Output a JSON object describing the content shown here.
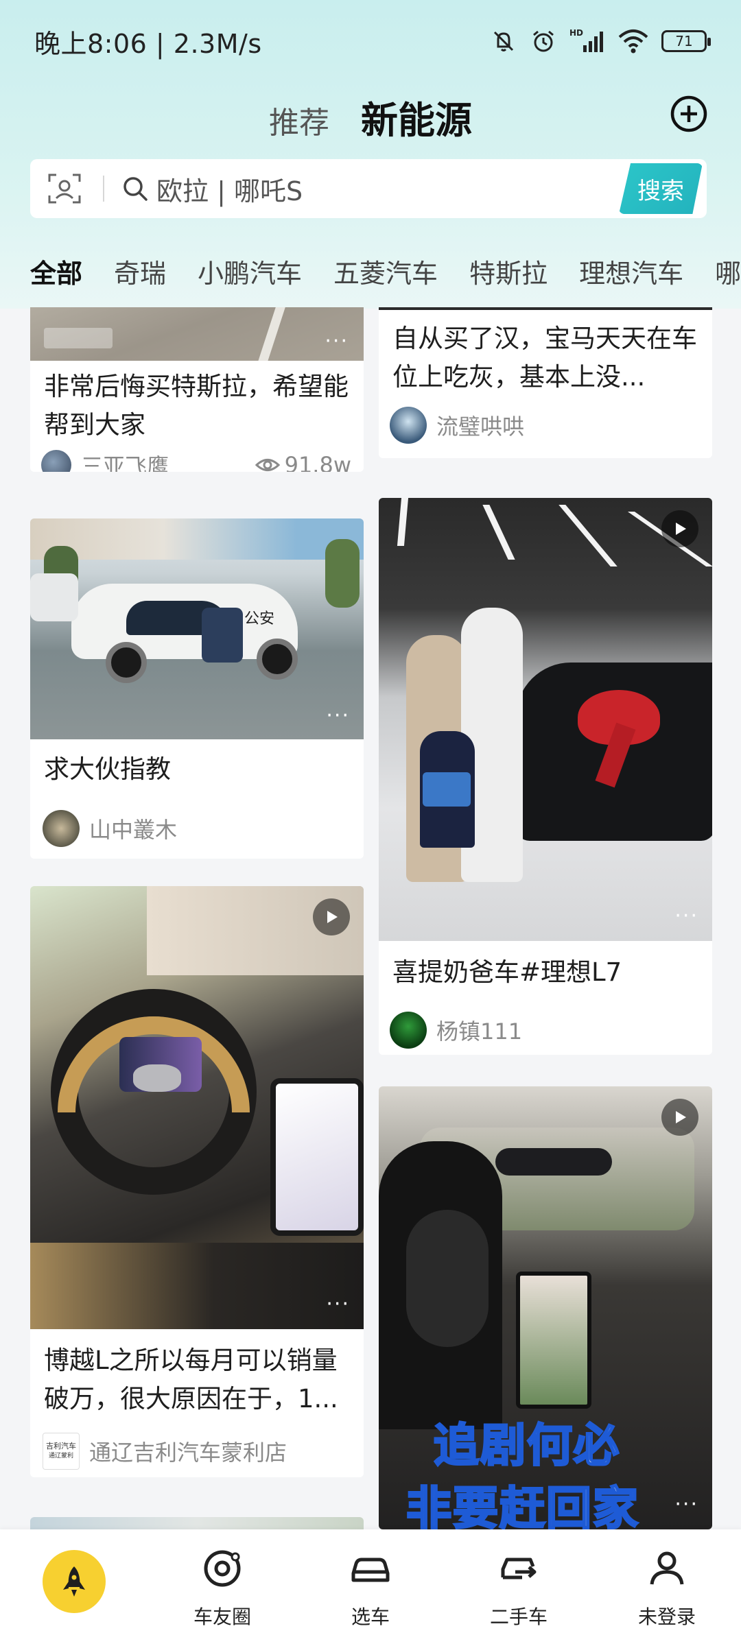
{
  "status_bar": {
    "time_speed": "晚上8:06 | 2.3M/s",
    "battery": "71"
  },
  "header": {
    "tab_recommend": "推荐",
    "tab_new_energy": "新能源"
  },
  "search": {
    "placeholder": "欧拉 | 哪吒S",
    "button_label": "搜索"
  },
  "categories": [
    "全部",
    "奇瑞",
    "小鹏汽车",
    "五菱汽车",
    "特斯拉",
    "理想汽车",
    "哪"
  ],
  "feed": {
    "left": [
      {
        "title": "非常后悔买特斯拉，希望能帮到大家",
        "author": "三亚飞鹰",
        "views": "91.8w"
      },
      {
        "title": "求大伙指教",
        "author": "山中叢木"
      },
      {
        "title": "博越L之所以每月可以销量破万，很大原因在于，1...",
        "author": "通辽吉利汽车蒙利店"
      }
    ],
    "right": [
      {
        "title": "自从买了汉，宝马天天在车位上吃灰，基本上没...",
        "author": "流璧哄哄"
      },
      {
        "title": "喜提奶爸车#理想L7",
        "author": "杨镇111"
      },
      {
        "overlay_text_1": "追剧何必",
        "overlay_text_2": "非要赶回家"
      }
    ]
  },
  "image_text": {
    "police": "公安",
    "dealer_logo": "吉利汽车",
    "dealer_logo_sub": "通辽蒙利"
  },
  "bottom_nav": [
    "车友圈",
    "选车",
    "二手车",
    "未登录"
  ],
  "colors": {
    "accent": "#2cc6c9",
    "rocket": "#f7d030"
  }
}
